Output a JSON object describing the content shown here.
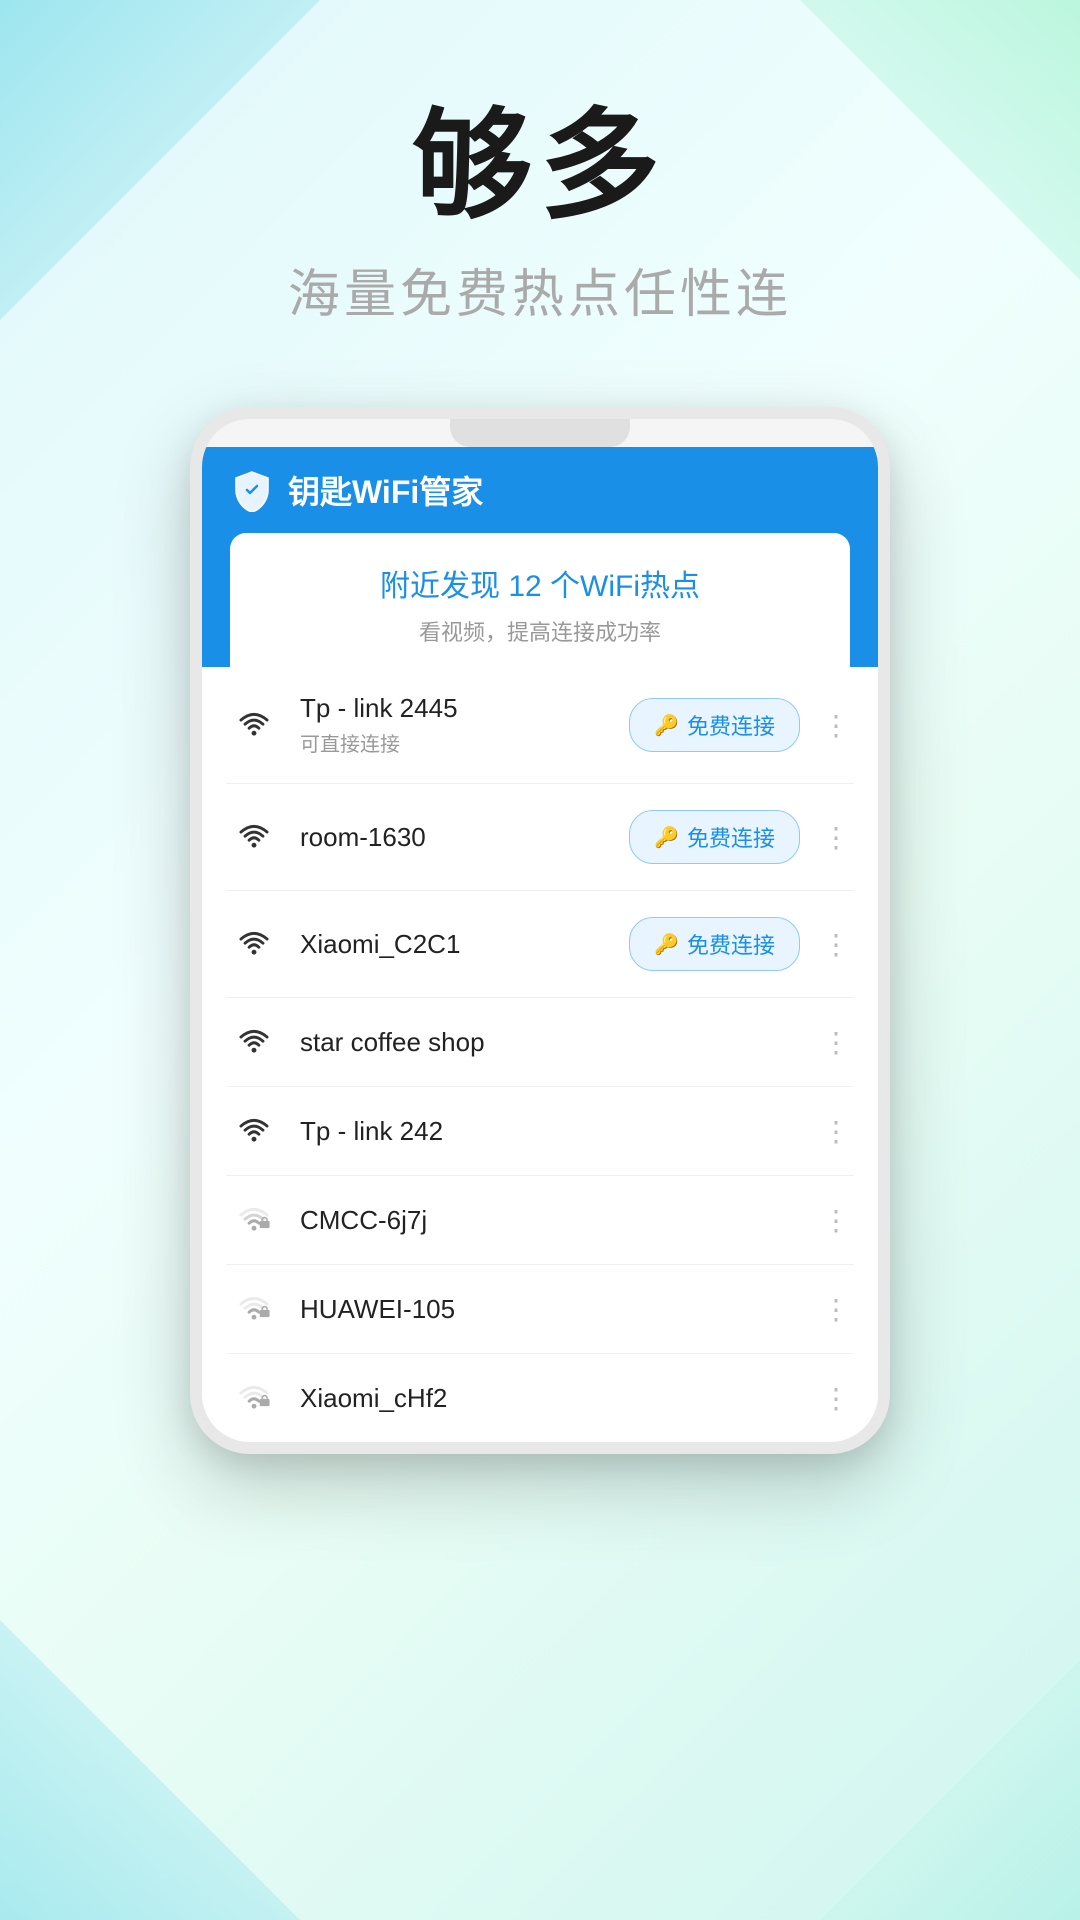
{
  "background": {
    "colors": [
      "#e0f7fa",
      "#f0fffe",
      "#e8fdf5",
      "#d0f5f0"
    ]
  },
  "hero": {
    "headline": "够多",
    "subtitle": "海量免费热点任性连"
  },
  "app": {
    "title": "钥匙WiFi管家",
    "discovery_text": "附近发现 12 个WiFi热点",
    "hint_text": "看视频，提高连接成功率",
    "connect_label": "免费连接",
    "wifi_networks": [
      {
        "name": "Tp - link 2445",
        "sub": "可直接连接",
        "can_connect": true,
        "locked": false,
        "signal": "full"
      },
      {
        "name": "room-1630",
        "sub": "",
        "can_connect": true,
        "locked": false,
        "signal": "full"
      },
      {
        "name": "Xiaomi_C2C1",
        "sub": "",
        "can_connect": true,
        "locked": false,
        "signal": "full"
      },
      {
        "name": "star coffee shop",
        "sub": "",
        "can_connect": false,
        "locked": false,
        "signal": "full"
      },
      {
        "name": "Tp - link 242",
        "sub": "",
        "can_connect": false,
        "locked": false,
        "signal": "full"
      },
      {
        "name": "CMCC-6j7j",
        "sub": "",
        "can_connect": false,
        "locked": true,
        "signal": "medium"
      },
      {
        "name": "HUAWEI-105",
        "sub": "",
        "can_connect": false,
        "locked": true,
        "signal": "low"
      },
      {
        "name": "Xiaomi_cHf2",
        "sub": "",
        "can_connect": false,
        "locked": true,
        "signal": "low"
      },
      {
        "name": "...",
        "sub": "",
        "can_connect": false,
        "locked": true,
        "signal": "low"
      }
    ]
  }
}
